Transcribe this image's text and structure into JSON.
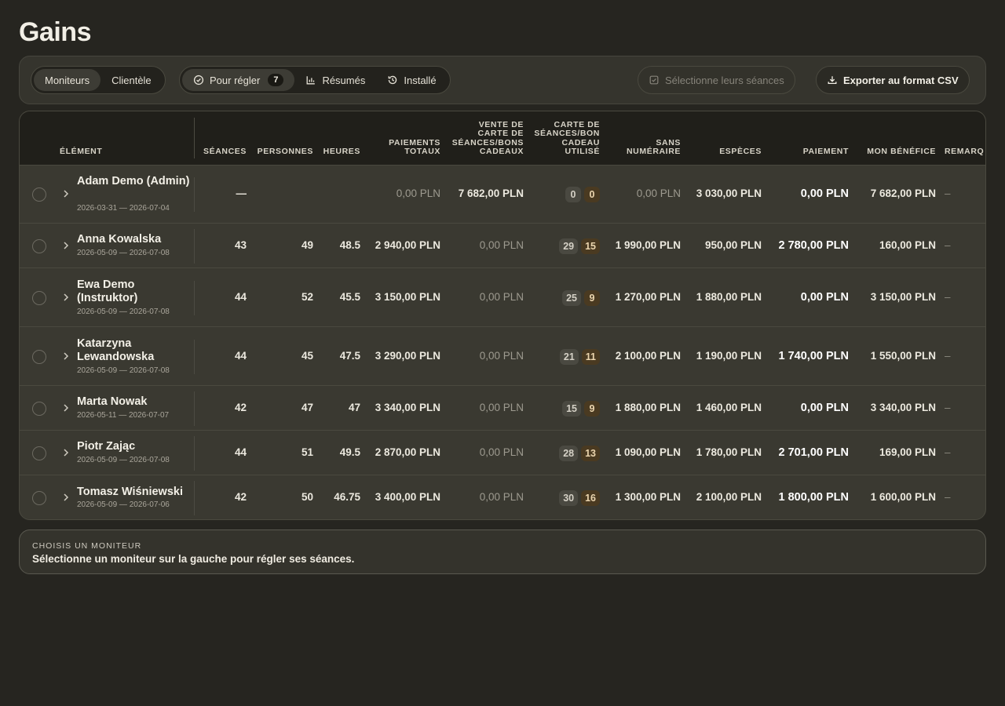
{
  "page": {
    "title": "Gains"
  },
  "toolbar": {
    "tabs": [
      {
        "label": "Moniteurs",
        "active": true
      },
      {
        "label": "Clientèle",
        "active": false
      }
    ],
    "filters": [
      {
        "label": "Pour régler",
        "icon": "check-circle-icon",
        "count": "7",
        "active": true
      },
      {
        "label": "Résumés",
        "icon": "bar-chart-icon",
        "active": false
      },
      {
        "label": "Installé",
        "icon": "history-icon",
        "active": false
      }
    ],
    "select_sessions_label": "Sélectionne leurs séances",
    "export_label": "Exporter au format CSV"
  },
  "table": {
    "headers": {
      "element": "Élément",
      "seances": "Séances",
      "personnes": "Personnes",
      "heures": "Heures",
      "paiements_l1": "Paiements",
      "paiements_l2": "totaux",
      "vente_l1": "Vente de",
      "vente_l2": "carte de",
      "vente_l3": "séances/bons",
      "vente_l4": "cadeaux",
      "carte_l1": "Carte de",
      "carte_l2": "séances/bon",
      "carte_l3": "cadeau",
      "carte_l4": "utilisé",
      "sans_l1": "Sans",
      "sans_l2": "numéraire",
      "especes": "Espèces",
      "paiement": "Paiement",
      "benefice": "Mon bénéfice",
      "remarque": "Remarq"
    },
    "rows": [
      {
        "name": "Adam Demo (Admin)",
        "dates": "2026-03-31 — 2026-07-04",
        "seances": "—",
        "personnes": "",
        "heures": "",
        "paiements": "0,00 PLN",
        "vente": "7 682,00 PLN",
        "used_a": "0",
        "used_b": "0",
        "sans": "0,00 PLN",
        "especes": "3 030,00 PLN",
        "paiement": "0,00 PLN",
        "benefice": "7 682,00 PLN",
        "remarque": "–"
      },
      {
        "name": "Anna Kowalska",
        "dates": "2026-05-09 — 2026-07-08",
        "seances": "43",
        "personnes": "49",
        "heures": "48.5",
        "paiements": "2 940,00 PLN",
        "vente": "0,00 PLN",
        "used_a": "29",
        "used_b": "15",
        "sans": "1 990,00 PLN",
        "especes": "950,00 PLN",
        "paiement": "2 780,00 PLN",
        "benefice": "160,00 PLN",
        "remarque": "–"
      },
      {
        "name": "Ewa Demo (Instruktor)",
        "dates": "2026-05-09 — 2026-07-08",
        "seances": "44",
        "personnes": "52",
        "heures": "45.5",
        "paiements": "3 150,00 PLN",
        "vente": "0,00 PLN",
        "used_a": "25",
        "used_b": "9",
        "sans": "1 270,00 PLN",
        "especes": "1 880,00 PLN",
        "paiement": "0,00 PLN",
        "benefice": "3 150,00 PLN",
        "remarque": "–"
      },
      {
        "name": "Katarzyna Lewandowska",
        "dates": "2026-05-09 — 2026-07-08",
        "seances": "44",
        "personnes": "45",
        "heures": "47.5",
        "paiements": "3 290,00 PLN",
        "vente": "0,00 PLN",
        "used_a": "21",
        "used_b": "11",
        "sans": "2 100,00 PLN",
        "especes": "1 190,00 PLN",
        "paiement": "1 740,00 PLN",
        "benefice": "1 550,00 PLN",
        "remarque": "–"
      },
      {
        "name": "Marta Nowak",
        "dates": "2026-05-11 — 2026-07-07",
        "seances": "42",
        "personnes": "47",
        "heures": "47",
        "paiements": "3 340,00 PLN",
        "vente": "0,00 PLN",
        "used_a": "15",
        "used_b": "9",
        "sans": "1 880,00 PLN",
        "especes": "1 460,00 PLN",
        "paiement": "0,00 PLN",
        "benefice": "3 340,00 PLN",
        "remarque": "–"
      },
      {
        "name": "Piotr Zając",
        "dates": "2026-05-09 — 2026-07-08",
        "seances": "44",
        "personnes": "51",
        "heures": "49.5",
        "paiements": "2 870,00 PLN",
        "vente": "0,00 PLN",
        "used_a": "28",
        "used_b": "13",
        "sans": "1 090,00 PLN",
        "especes": "1 780,00 PLN",
        "paiement": "2 701,00 PLN",
        "benefice": "169,00 PLN",
        "remarque": "–"
      },
      {
        "name": "Tomasz Wiśniewski",
        "dates": "2026-05-09 — 2026-07-06",
        "seances": "42",
        "personnes": "50",
        "heures": "46.75",
        "paiements": "3 400,00 PLN",
        "vente": "0,00 PLN",
        "used_a": "30",
        "used_b": "16",
        "sans": "1 300,00 PLN",
        "especes": "2 100,00 PLN",
        "paiement": "1 800,00 PLN",
        "benefice": "1 600,00 PLN",
        "remarque": "–"
      }
    ]
  },
  "info": {
    "label": "CHOISIS UN MONITEUR",
    "text": "Sélectionne un moniteur sur la gauche pour régler ses séances."
  }
}
